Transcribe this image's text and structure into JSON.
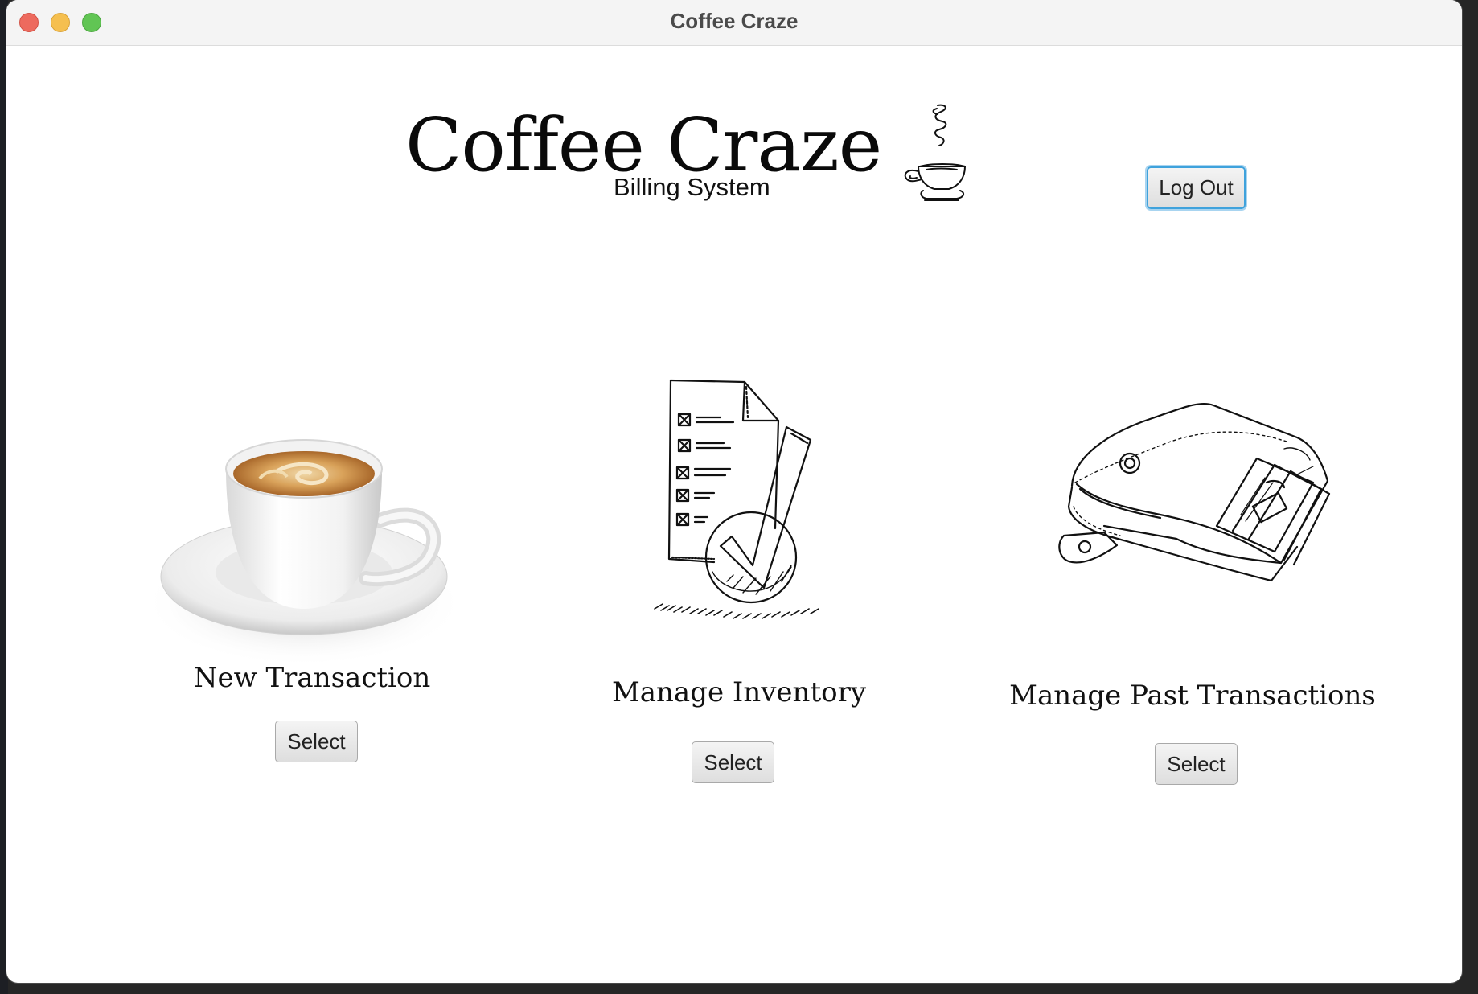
{
  "window": {
    "title": "Coffee Craze"
  },
  "header": {
    "app_title": "Coffee Craze",
    "subtitle": "Billing System",
    "logout_label": "Log Out",
    "logo_icon": "steaming-coffee-cup-icon"
  },
  "options": [
    {
      "label": "New Transaction",
      "button_label": "Select",
      "icon": "coffee-cup-saucer-image"
    },
    {
      "label": "Manage Inventory",
      "button_label": "Select",
      "icon": "checklist-document-icon"
    },
    {
      "label": "Manage Past Transactions",
      "button_label": "Select",
      "icon": "wallet-with-cash-icon"
    }
  ],
  "colors": {
    "focus_ring": "#3fa2dc",
    "traffic_close": "#ed6a5e",
    "traffic_minimize": "#f5bf4f",
    "traffic_maximize": "#61c554"
  }
}
